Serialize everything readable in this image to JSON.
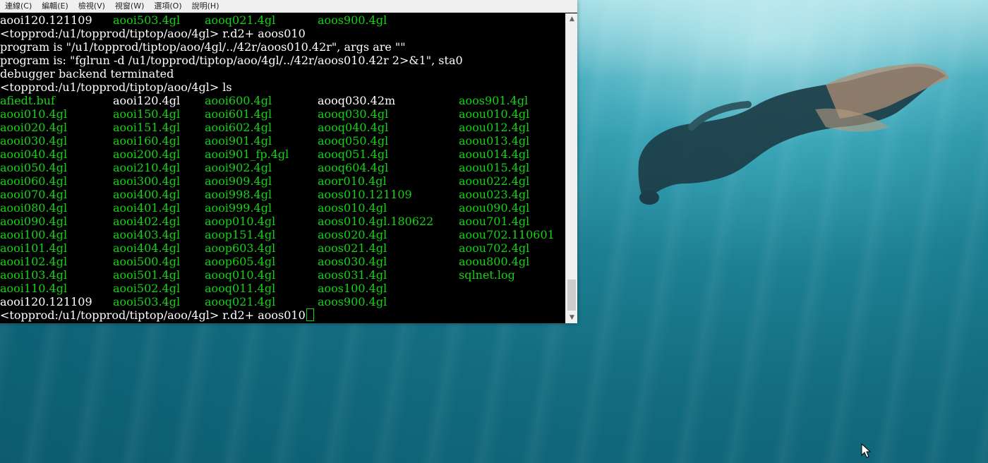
{
  "menu": [
    "連線(C)",
    "編輯(E)",
    "檢視(V)",
    "視窗(W)",
    "選項(O)",
    "說明(H)"
  ],
  "terminal": {
    "lines": [
      [
        {
          "t": "aooi120.121109",
          "c": "w"
        },
        {
          "t": "aooi503.4gl",
          "c": "g"
        },
        {
          "t": "aooq021.4gl",
          "c": "g"
        },
        {
          "t": "aoos900.4gl",
          "c": "g"
        }
      ],
      [
        {
          "t": "<topprod:/u1/topprod/tiptop/aoo/4gl> r.d2+ aoos010",
          "c": "w"
        }
      ],
      [
        {
          "t": "program is \"/u1/topprod/tiptop/aoo/4gl/../42r/aoos010.42r\", args are \"\"",
          "c": "w"
        }
      ],
      [
        {
          "t": "program is: \"fglrun -d /u1/topprod/tiptop/aoo/4gl/../42r/aoos010.42r 2>&1\", sta0",
          "c": "w"
        }
      ],
      [
        {
          "t": "debugger backend terminated",
          "c": "w"
        }
      ],
      [
        {
          "t": "<topprod:/u1/topprod/tiptop/aoo/4gl> ls",
          "c": "w"
        }
      ],
      [
        {
          "t": "afiedt.buf",
          "c": "g"
        },
        {
          "t": "aooi120.4gl",
          "c": "w"
        },
        {
          "t": "aooi600.4gl",
          "c": "g"
        },
        {
          "t": "aooq030.42m",
          "c": "w"
        },
        {
          "t": "aoos901.4gl",
          "c": "g"
        }
      ],
      [
        {
          "t": "aooi010.4gl",
          "c": "g"
        },
        {
          "t": "aooi150.4gl",
          "c": "g"
        },
        {
          "t": "aooi601.4gl",
          "c": "g"
        },
        {
          "t": "aooq030.4gl",
          "c": "g"
        },
        {
          "t": "aoou010.4gl",
          "c": "g"
        }
      ],
      [
        {
          "t": "aooi020.4gl",
          "c": "g"
        },
        {
          "t": "aooi151.4gl",
          "c": "g"
        },
        {
          "t": "aooi602.4gl",
          "c": "g"
        },
        {
          "t": "aooq040.4gl",
          "c": "g"
        },
        {
          "t": "aoou012.4gl",
          "c": "g"
        }
      ],
      [
        {
          "t": "aooi030.4gl",
          "c": "g"
        },
        {
          "t": "aooi160.4gl",
          "c": "g"
        },
        {
          "t": "aooi901.4gl",
          "c": "g"
        },
        {
          "t": "aooq050.4gl",
          "c": "g"
        },
        {
          "t": "aoou013.4gl",
          "c": "g"
        }
      ],
      [
        {
          "t": "aooi040.4gl",
          "c": "g"
        },
        {
          "t": "aooi200.4gl",
          "c": "g"
        },
        {
          "t": "aooi901_fp.4gl",
          "c": "g"
        },
        {
          "t": "aooq051.4gl",
          "c": "g"
        },
        {
          "t": "aoou014.4gl",
          "c": "g"
        }
      ],
      [
        {
          "t": "aooi050.4gl",
          "c": "g"
        },
        {
          "t": "aooi210.4gl",
          "c": "g"
        },
        {
          "t": "aooi902.4gl",
          "c": "g"
        },
        {
          "t": "aooq604.4gl",
          "c": "g"
        },
        {
          "t": "aoou015.4gl",
          "c": "g"
        }
      ],
      [
        {
          "t": "aooi060.4gl",
          "c": "g"
        },
        {
          "t": "aooi300.4gl",
          "c": "g"
        },
        {
          "t": "aooi909.4gl",
          "c": "g"
        },
        {
          "t": "aoor010.4gl",
          "c": "g"
        },
        {
          "t": "aoou022.4gl",
          "c": "g"
        }
      ],
      [
        {
          "t": "aooi070.4gl",
          "c": "g"
        },
        {
          "t": "aooi400.4gl",
          "c": "g"
        },
        {
          "t": "aooi998.4gl",
          "c": "g"
        },
        {
          "t": "aoos010.121109",
          "c": "g"
        },
        {
          "t": "aoou023.4gl",
          "c": "g"
        }
      ],
      [
        {
          "t": "aooi080.4gl",
          "c": "g"
        },
        {
          "t": "aooi401.4gl",
          "c": "g"
        },
        {
          "t": "aooi999.4gl",
          "c": "g"
        },
        {
          "t": "aoos010.4gl",
          "c": "g"
        },
        {
          "t": "aoou090.4gl",
          "c": "g"
        }
      ],
      [
        {
          "t": "aooi090.4gl",
          "c": "g"
        },
        {
          "t": "aooi402.4gl",
          "c": "g"
        },
        {
          "t": "aoop010.4gl",
          "c": "g"
        },
        {
          "t": "aoos010.4gl.180622",
          "c": "g"
        },
        {
          "t": "aoou701.4gl",
          "c": "g"
        }
      ],
      [
        {
          "t": "aooi100.4gl",
          "c": "g"
        },
        {
          "t": "aooi403.4gl",
          "c": "g"
        },
        {
          "t": "aoop151.4gl",
          "c": "g"
        },
        {
          "t": "aoos020.4gl",
          "c": "g"
        },
        {
          "t": "aoou702.110601",
          "c": "g"
        }
      ],
      [
        {
          "t": "aooi101.4gl",
          "c": "g"
        },
        {
          "t": "aooi404.4gl",
          "c": "g"
        },
        {
          "t": "aoop603.4gl",
          "c": "g"
        },
        {
          "t": "aoos021.4gl",
          "c": "g"
        },
        {
          "t": "aoou702.4gl",
          "c": "g"
        }
      ],
      [
        {
          "t": "aooi102.4gl",
          "c": "g"
        },
        {
          "t": "aooi500.4gl",
          "c": "g"
        },
        {
          "t": "aoop605.4gl",
          "c": "g"
        },
        {
          "t": "aoos030.4gl",
          "c": "g"
        },
        {
          "t": "aoou800.4gl",
          "c": "g"
        }
      ],
      [
        {
          "t": "aooi103.4gl",
          "c": "g"
        },
        {
          "t": "aooi501.4gl",
          "c": "g"
        },
        {
          "t": "aooq010.4gl",
          "c": "g"
        },
        {
          "t": "aoos031.4gl",
          "c": "g"
        },
        {
          "t": "sqlnet.log",
          "c": "g"
        }
      ],
      [
        {
          "t": "aooi110.4gl",
          "c": "g"
        },
        {
          "t": "aooi502.4gl",
          "c": "g"
        },
        {
          "t": "aooq011.4gl",
          "c": "g"
        },
        {
          "t": "aoos100.4gl",
          "c": "g"
        }
      ],
      [
        {
          "t": "aooi120.121109",
          "c": "w"
        },
        {
          "t": "aooi503.4gl",
          "c": "g"
        },
        {
          "t": "aooq021.4gl",
          "c": "g"
        },
        {
          "t": "aoos900.4gl",
          "c": "g"
        }
      ]
    ],
    "prompt": "<topprod:/u1/topprod/tiptop/aoo/4gl> r.d2+ aoos010"
  }
}
